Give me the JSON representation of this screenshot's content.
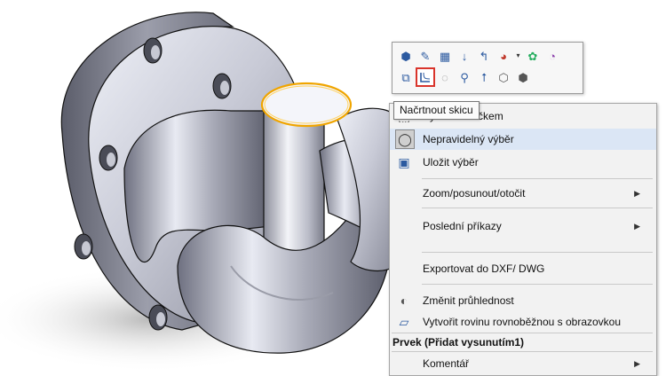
{
  "toolbar": {
    "row1": [
      {
        "name": "view-orientation-icon",
        "glyph": "⬢"
      },
      {
        "name": "edit-sketch-icon",
        "glyph": "✎"
      },
      {
        "name": "edit-feature-icon",
        "glyph": "▦"
      },
      {
        "name": "rollback-icon",
        "glyph": "↓"
      },
      {
        "name": "parent-child-icon",
        "glyph": "↰"
      },
      {
        "name": "appearance-icon",
        "glyph": "◕"
      },
      {
        "name": "appearance-dropdown-icon",
        "glyph": "▾"
      },
      {
        "name": "color-palette-icon",
        "glyph": "✿"
      },
      {
        "name": "display-states-icon",
        "glyph": "◔"
      }
    ],
    "row2": [
      {
        "name": "select-other-icon",
        "glyph": "⧉"
      },
      {
        "name": "sketch-icon",
        "glyph": "∟"
      },
      {
        "name": "hide-show-icon",
        "glyph": "◌"
      },
      {
        "name": "zoom-selection-icon",
        "glyph": "⚲"
      },
      {
        "name": "normal-to-icon",
        "glyph": "⭡"
      },
      {
        "name": "isometric-view-icon",
        "glyph": "⬡"
      },
      {
        "name": "view-cube-icon",
        "glyph": "⬢"
      }
    ]
  },
  "tooltip": {
    "text": "Načrtnout skicu"
  },
  "menu": {
    "items": [
      {
        "label": "Výběr rámečkem"
      },
      {
        "label": "Nepravidelný výběr"
      },
      {
        "label": "Uložit výběr"
      },
      {
        "label": "Zoom/posunout/otočit"
      },
      {
        "label": "Poslední příkazy"
      },
      {
        "label": "Exportovat  do DXF/ DWG"
      },
      {
        "label": "Změnit průhlednost"
      },
      {
        "label": "Vytvořit rovinu rovnoběžnou s obrazovkou"
      }
    ],
    "section_header": "Prvek (Přidat vysunutím1)",
    "last_item": {
      "label": "Komentář"
    }
  },
  "colors": {
    "highlight_edge": "#f0a500",
    "selected_outline": "#d9342b"
  }
}
